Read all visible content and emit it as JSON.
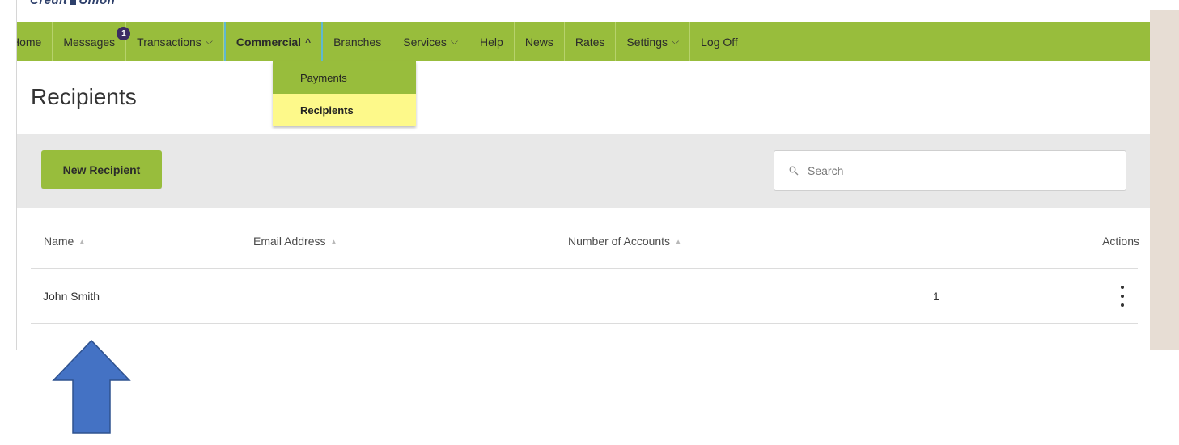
{
  "brand": {
    "logo_text_left": "Credit",
    "logo_text_right": "Union"
  },
  "nav": {
    "items": [
      {
        "label": "Home",
        "chevron": ""
      },
      {
        "label": "Messages",
        "chevron": "",
        "badge": "1"
      },
      {
        "label": "Transactions",
        "chevron": "⌵"
      },
      {
        "label": "Commercial",
        "chevron": "^"
      },
      {
        "label": "Branches",
        "chevron": ""
      },
      {
        "label": "Services",
        "chevron": "⌵"
      },
      {
        "label": "Help",
        "chevron": ""
      },
      {
        "label": "News",
        "chevron": ""
      },
      {
        "label": "Rates",
        "chevron": ""
      },
      {
        "label": "Settings",
        "chevron": "⌵"
      },
      {
        "label": "Log Off",
        "chevron": ""
      }
    ],
    "active": "Commercial"
  },
  "commercial_menu": {
    "items": [
      {
        "label": "Payments"
      },
      {
        "label": "Recipients"
      }
    ],
    "highlighted": "Recipients"
  },
  "page": {
    "title": "Recipients"
  },
  "toolbar": {
    "new_button_label": "New Recipient",
    "search_placeholder": "Search",
    "search_icon": "search-icon"
  },
  "table": {
    "columns": [
      {
        "label": "Name"
      },
      {
        "label": "Email Address"
      },
      {
        "label": "Number of Accounts"
      },
      {
        "label": "Actions"
      }
    ],
    "sort_glyph": "▲",
    "rows": [
      {
        "name": "John Smith",
        "email": "",
        "accounts": "1",
        "actions_icon": "more-vertical-icon"
      }
    ]
  },
  "colors": {
    "nav_green": "#98bd3c",
    "highlight_yellow": "#fdf98a",
    "badge_purple": "#3b2c63",
    "active_tab_border": "#5fb8cf",
    "toolbar_gray": "#e8e8e8",
    "annotation_arrow": "#4472c4"
  }
}
